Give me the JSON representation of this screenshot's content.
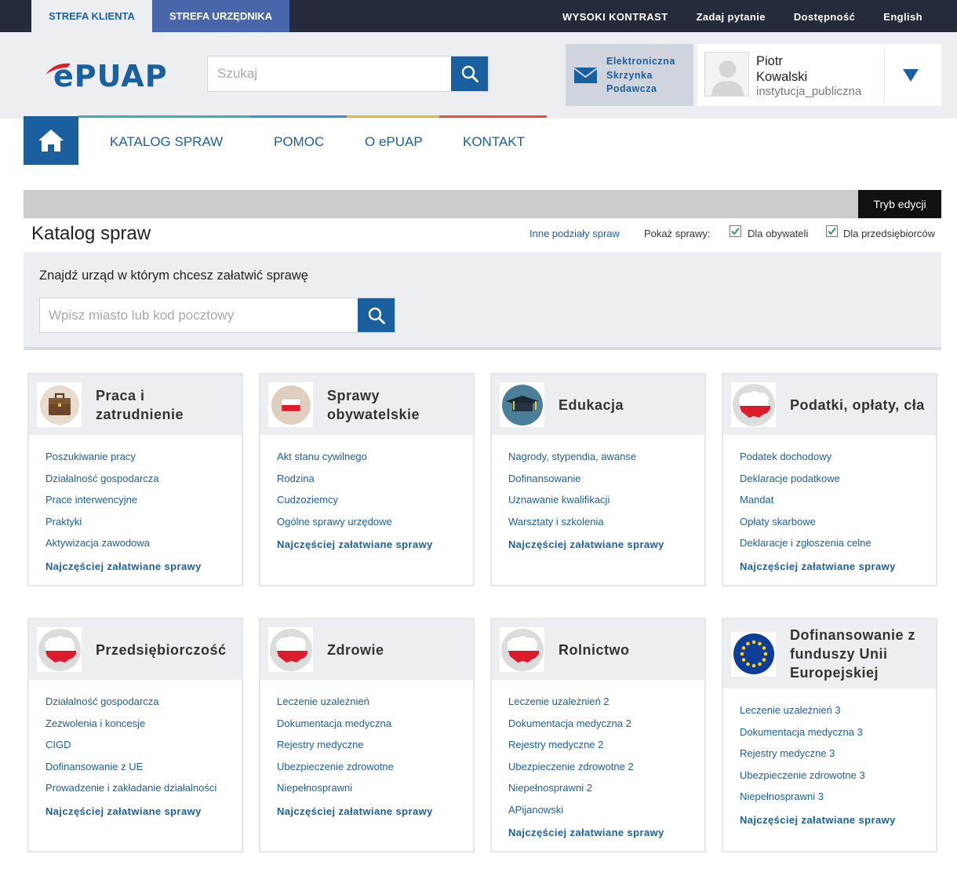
{
  "topbar": {
    "zone_client": "STREFA KLIENTA",
    "zone_official": "STREFA URZĘDNIKA",
    "links": [
      "WYSOKI KONTRAST",
      "Zadaj pytanie",
      "Dostępność",
      "English"
    ]
  },
  "header": {
    "logo_text": "ePUAP",
    "search_placeholder": "Szukaj",
    "esp_label": "Elektroniczna Skrzynka Podawcza",
    "user_first": "Piotr",
    "user_last": "Kowalski",
    "user_role": "instytucja_publiczna"
  },
  "nav": {
    "items": [
      "KATALOG SPRAW",
      "POMOC",
      "O ePUAP",
      "KONTAKT"
    ],
    "stripe_colors": [
      "#3db39e",
      "#2f95d6",
      "#f2b631",
      "#e0563c"
    ]
  },
  "content": {
    "edit_mode": "Tryb edycji",
    "page_title": "Katalog spraw",
    "other_divisions": "Inne podziały spraw",
    "show_label": "Pokaż sprawy:",
    "filter_citizens": "Dla obywateli",
    "filter_business": "Dla przedsiębiorców",
    "finder_title": "Znajdź urząd w którym chcesz załatwić sprawę",
    "finder_placeholder": "Wpisz miasto lub kod pocztowy"
  },
  "footer_label": "Najczęściej załatwiane sprawy",
  "cards": [
    {
      "title": "Praca i zatrudnienie",
      "icon": "briefcase-icon",
      "links": [
        "Poszukiwanie pracy",
        "Działalność gospodarcza",
        "Prace interwencyjne",
        "Praktyki",
        "Aktywizacja zawodowa"
      ]
    },
    {
      "title": "Sprawy obywatelskie",
      "icon": "flag-icon",
      "links": [
        "Akt stanu cywilnego",
        "Rodzina",
        "Cudzoziemcy",
        "Ogólne sprawy urzędowe"
      ]
    },
    {
      "title": "Edukacja",
      "icon": "graduation-cap-icon",
      "links": [
        "Nagrody, stypendia, awanse",
        "Dofinansowanie",
        "Uznawanie kwalifikacji",
        "Warsztaty i szkolenia"
      ]
    },
    {
      "title": "Podatki, opłaty, cła",
      "icon": "poland-map-icon",
      "links": [
        "Podatek dochodowy",
        "Deklaracje podatkowe",
        "Mandat",
        "Opłaty skarbowe",
        "Deklaracje i zgłoszenia celne"
      ]
    },
    {
      "title": "Przedsiębiorczość",
      "icon": "poland-map-icon",
      "links": [
        "Działalność gospodarcza",
        "Zezwolenia i koncesje",
        "CIGD",
        "Dofinansowanie z UE",
        "Prowadzenie i zakładanie działalności"
      ]
    },
    {
      "title": "Zdrowie",
      "icon": "poland-map-icon",
      "links": [
        "Leczenie uzależnień",
        "Dokumentacja medyczna",
        "Rejestry medyczne",
        "Ubezpieczenie zdrowotne",
        "Niepełnosprawni"
      ]
    },
    {
      "title": "Rolnictwo",
      "icon": "poland-map-icon",
      "links": [
        "Leczenie uzależnień 2",
        "Dokumentacja medyczna 2",
        "Rejestry medyczne 2",
        "Ubezpieczenie zdrowotne 2",
        "Niepełnosprawni 2",
        "APijanowski"
      ]
    },
    {
      "title": "Dofinansowanie z funduszy Unii Europejskiej",
      "icon": "eu-flag-icon",
      "links": [
        "Leczenie uzależnień 3",
        "Dokumentacja medyczna 3",
        "Rejestry medyczne 3",
        "Ubezpieczenie zdrowotne 3",
        "Niepełnosprawni 3"
      ]
    }
  ]
}
